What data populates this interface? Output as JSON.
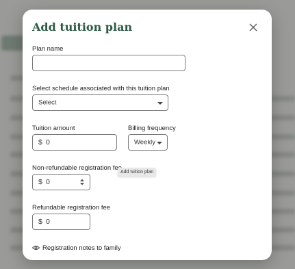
{
  "modal": {
    "title": "Add tuition plan",
    "close_icon": "close-icon"
  },
  "form": {
    "plan_name": {
      "label": "Plan name",
      "value": ""
    },
    "schedule": {
      "label": "Select schedule associated with this tuition plan",
      "selected": "Select"
    },
    "tuition_amount": {
      "label": "Tuition amount",
      "currency": "$",
      "value": "0"
    },
    "billing_frequency": {
      "label": "Billing frequency",
      "selected": "Weekly"
    },
    "non_refundable_fee": {
      "label": "Non-refundable registration fee",
      "currency": "$",
      "value": "0"
    },
    "refundable_fee": {
      "label": "Refundable registration fee",
      "currency": "$",
      "value": "0"
    },
    "notes": {
      "label": "Registration notes to family",
      "icon": "eye-icon"
    }
  },
  "tooltip": {
    "text": "Add tuition plan"
  },
  "colors": {
    "title": "#2d5a46",
    "backdrop": "#8a8a8a"
  }
}
